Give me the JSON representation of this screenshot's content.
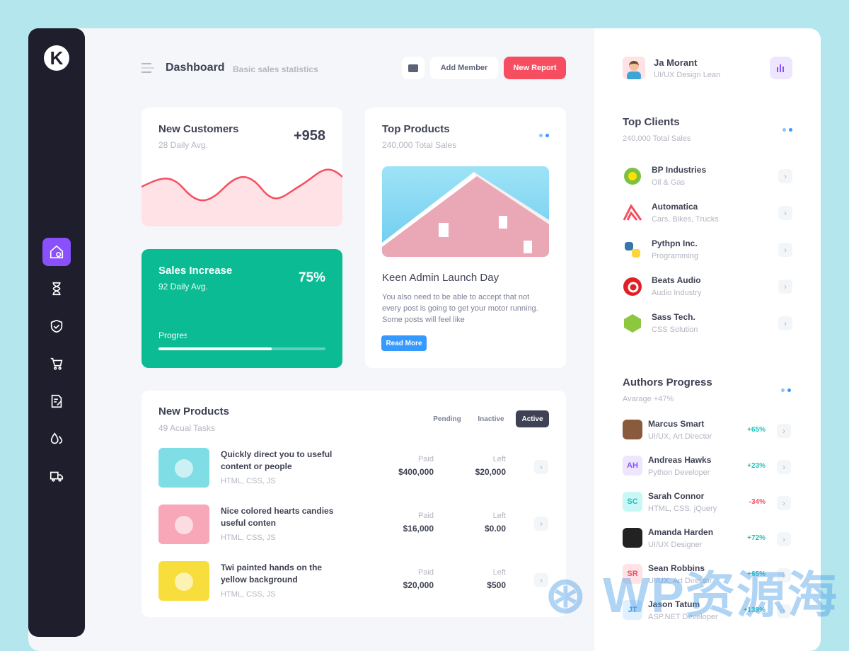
{
  "header": {
    "title": "Dashboard",
    "subtitle": "Basic sales statistics",
    "add_member": "Add Member",
    "new_report": "New Report"
  },
  "sidebar": {
    "logo": "K",
    "items": [
      {
        "icon": "home-icon",
        "active": true
      },
      {
        "icon": "hourglass-icon"
      },
      {
        "icon": "shield-icon"
      },
      {
        "icon": "cart-icon"
      },
      {
        "icon": "document-edit-icon"
      },
      {
        "icon": "drops-icon"
      },
      {
        "icon": "truck-icon"
      }
    ]
  },
  "new_customers": {
    "title": "New Customers",
    "subtitle": "28 Daily Avg.",
    "value": "+958"
  },
  "sales_increase": {
    "title": "Sales Increase",
    "subtitle": "92 Daily Avg.",
    "value": "75%",
    "progress_label": "Progress",
    "progress": 0.68
  },
  "top_products": {
    "title": "Top Products",
    "subtitle": "240,000 Total Sales",
    "post_title": "Keen Admin Launch Day",
    "post_text": "You also need to be able to accept that not every post is going to get your motor running. Some posts will feel like",
    "read_more": "Read More"
  },
  "new_products": {
    "title": "New Products",
    "subtitle": "49 Acual Tasks",
    "tabs": [
      "Pending",
      "Inactive",
      "Active"
    ],
    "active_tab": "Active",
    "paid_label": "Paid",
    "left_label": "Left",
    "rows": [
      {
        "title": "Quickly direct you to useful content or people",
        "tags": "HTML, CSS, JS",
        "paid": "$400,000",
        "left": "$20,000"
      },
      {
        "title": "Nice colored hearts candies useful conten",
        "tags": "HTML, CSS, JS",
        "paid": "$16,000",
        "left": "$0.00"
      },
      {
        "title": "Twi painted hands on the yellow background",
        "tags": "HTML, CSS, JS",
        "paid": "$20,000",
        "left": "$500"
      }
    ]
  },
  "user": {
    "name": "Ja Morant",
    "role": "UI/UX Design Lean"
  },
  "top_clients": {
    "title": "Top Clients",
    "subtitle": "240,000 Total Sales",
    "items": [
      {
        "name": "BP Industries",
        "desc": "Oil & Gas"
      },
      {
        "name": "Automatica",
        "desc": "Cars, Bikes, Trucks"
      },
      {
        "name": "Pythpn Inc.",
        "desc": "Programming"
      },
      {
        "name": "Beats Audio",
        "desc": "Audio Industry"
      },
      {
        "name": "Sass Tech.",
        "desc": "CSS Solution"
      }
    ]
  },
  "authors": {
    "title": "Authors Progress",
    "subtitle": "Avarage +47%",
    "items": [
      {
        "name": "Marcus Smart",
        "role": "UI/UX, Art Director",
        "pct": "+65%",
        "initials": "",
        "color": "#1bc5bd"
      },
      {
        "name": "Andreas Hawks",
        "role": "Python Developer",
        "pct": "+23%",
        "initials": "AH",
        "color": "#1bc5bd"
      },
      {
        "name": "Sarah Connor",
        "role": "HTML, CSS. jQuery",
        "pct": "-34%",
        "initials": "SC",
        "color": "#f64e60"
      },
      {
        "name": "Amanda Harden",
        "role": "UI/UX Designer",
        "pct": "+72%",
        "initials": "",
        "color": "#1bc5bd"
      },
      {
        "name": "Sean Robbins",
        "role": "UI/UX, Art Director",
        "pct": "+65%",
        "initials": "SR",
        "color": "#1bc5bd"
      },
      {
        "name": "Jason Tatum",
        "role": "ASP.NET Developer",
        "pct": "+139%",
        "initials": "JT",
        "color": "#1bc5bd"
      }
    ]
  },
  "colors": {
    "accent_purple": "#8950fc",
    "danger": "#f64e60",
    "success": "#0bbb94",
    "primary": "#3699ff",
    "dark": "#1e1e2d"
  },
  "watermark": "WP资源海"
}
